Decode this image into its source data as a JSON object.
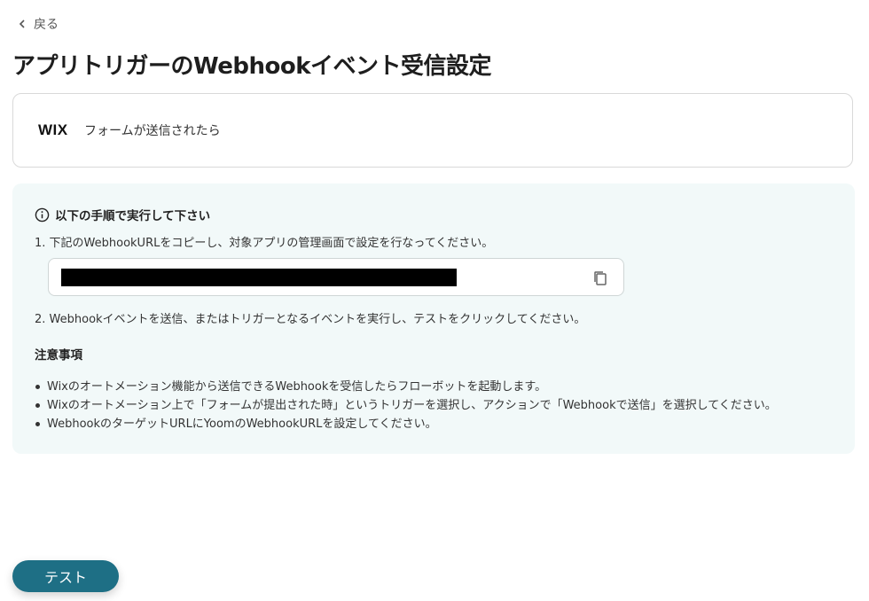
{
  "nav": {
    "back_label": "戻る"
  },
  "page": {
    "title": "アプリトリガーのWebhookイベント受信設定"
  },
  "app": {
    "logo_text": "WIX",
    "trigger_label": "フォームが送信されたら"
  },
  "instructions": {
    "heading": "以下の手順で実行して下さい",
    "step1": "1. 下記のWebhookURLをコピーし、対象アプリの管理画面で設定を行なってください。",
    "step2": "2. Webhookイベントを送信、またはトリガーとなるイベントを実行し、テストをクリックしてください。"
  },
  "notes": {
    "title": "注意事項",
    "items": [
      "Wixのオートメーション機能から送信できるWebhookを受信したらフローボットを起動します。",
      "Wixのオートメーション上で「フォームが提出された時」というトリガーを選択し、アクションで「Webhookで送信」を選択してください。",
      "WebhookのターゲットURLにYoomのWebhookURLを設定してください。"
    ]
  },
  "actions": {
    "test_label": "テスト"
  },
  "colors": {
    "accent": "#1e6f85",
    "panel_bg": "#f2f9f9"
  }
}
